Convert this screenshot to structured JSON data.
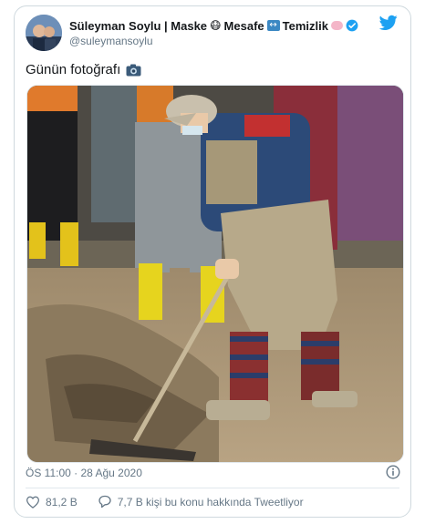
{
  "tweet": {
    "display_name": "Süleyman Soylu | Maske",
    "name_part2": "Mesafe",
    "name_part3": "Temizlik",
    "emoji_mask": "😷",
    "emoji_arrows": "↔",
    "emoji_soap": "🧼",
    "handle": "@suleymansoylu",
    "text": "Günün fotoğrafı",
    "text_emoji": "📷",
    "timestamp": "ÖS 11:00 · 28 Ağu 2020",
    "likes": "81,2 B",
    "replies_text": "7,7 B kişi bu konu hakkında Tweetliyor"
  },
  "colors": {
    "twitter_blue": "#1da1f2",
    "muted": "#657786",
    "verified": "#1da1f2",
    "border": "#cfd9de"
  },
  "icons": {
    "verified": "verified-badge-icon",
    "bird": "twitter-bird-icon",
    "camera": "camera-icon",
    "info": "info-icon",
    "like": "heart-icon",
    "reply": "speech-bubble-icon"
  }
}
